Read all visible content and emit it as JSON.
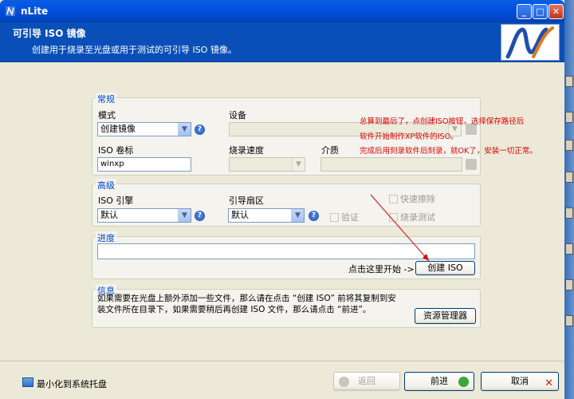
{
  "window": {
    "title": "nLite"
  },
  "header": {
    "title": "可引导 ISO 镜像",
    "subtitle": "创建用于烧录至光盘或用于测试的可引导 ISO 镜像。"
  },
  "general": {
    "label": "常规",
    "mode_label": "模式",
    "mode_value": "创建镜像",
    "device_label": "设备",
    "device_value": "",
    "iso_label_label": "ISO 卷标",
    "iso_label_value": "winxp",
    "burn_speed_label": "烧录速度",
    "media_label": "介质"
  },
  "advanced": {
    "label": "高级",
    "engine_label": "ISO 引擎",
    "engine_value": "默认",
    "boot_sector_label": "引导扇区",
    "boot_sector_value": "默认",
    "verify_label": "验证",
    "quick_erase_label": "快速擦除",
    "burn_test_label": "烧录测试"
  },
  "progress": {
    "label": "进度",
    "hint": "点击这里开始 ->",
    "make_iso_button": "创建 ISO"
  },
  "info": {
    "label": "信息",
    "line1": "如果需要在光盘上额外添加一些文件，那么请在点击 “创建 ISO” 前将其复制到安",
    "line2": "装文件所在目录下，如果需要稍后再创建 ISO 文件，那么请点击 “前进”。",
    "explorer_button": "资源管理器"
  },
  "annotation": {
    "line1": "总算到最后了，点创建ISO按钮，选择保存路径后",
    "line2": "软件开始制作XP软件的ISO。",
    "line3": "完成后用刻录软件后刻录，就OK了，安装一切正常。"
  },
  "footer": {
    "tray_label": "最小化到系统托盘",
    "back_button": "返回",
    "next_button": "前进",
    "cancel_button": "取消"
  },
  "colors": {
    "accent": "#0046d5",
    "annotation": "#e00000",
    "titlebar": "#0054e3"
  }
}
